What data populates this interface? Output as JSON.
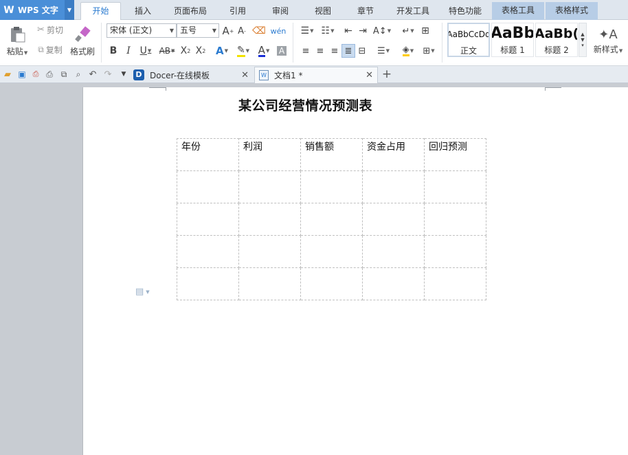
{
  "app": {
    "logo_text": "WPS 文字"
  },
  "menu": {
    "tabs": [
      "开始",
      "插入",
      "页面布局",
      "引用",
      "审阅",
      "视图",
      "章节",
      "开发工具",
      "特色功能",
      "表格工具",
      "表格样式"
    ],
    "active": "开始"
  },
  "ribbon": {
    "paste_label": "粘贴",
    "cut_label": "剪切",
    "copy_label": "复制",
    "format_painter_label": "格式刷",
    "font_name": "宋体 (正文)",
    "font_size": "五号",
    "styles": [
      {
        "sample": "AaBbCcDd",
        "name": "正文"
      },
      {
        "sample": "AaBb",
        "name": "标题 1"
      },
      {
        "sample": "AaBb(",
        "name": "标题 2"
      }
    ],
    "new_style_label": "新样式",
    "colors": {
      "font_color": "#1a2fd6",
      "highlight_color": "#f2e200",
      "shading_color": "#ffcc00"
    }
  },
  "doc_tabs": [
    {
      "label": "Docer-在线模板"
    },
    {
      "label": "文档1 *"
    }
  ],
  "document": {
    "title": "某公司经营情况预测表",
    "table": {
      "headers": [
        "年份",
        "利润",
        "销售额",
        "资金占用",
        "回归预测"
      ],
      "rows": [
        [
          "",
          "",
          "",
          "",
          ""
        ],
        [
          "",
          "",
          "",
          "",
          ""
        ],
        [
          "",
          "",
          "",
          "",
          ""
        ],
        [
          "",
          "",
          "",
          "",
          ""
        ]
      ]
    }
  }
}
